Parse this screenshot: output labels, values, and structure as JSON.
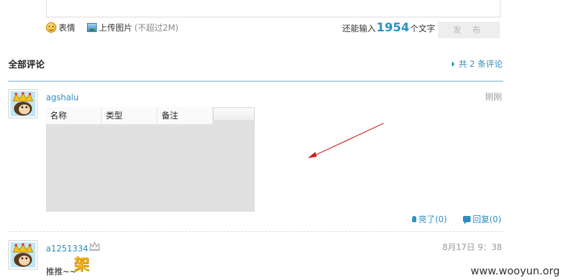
{
  "composer": {
    "emoji_label": "表情",
    "upload_label": "上传图片",
    "upload_limit": "(不超过2M)",
    "remaining_prefix": "还能输入",
    "remaining_count": "1954",
    "remaining_suffix": "个文字",
    "publish_label": "发 布"
  },
  "comments_header": {
    "title": "全部评论",
    "total_label": "共 2 条评论"
  },
  "comments": [
    {
      "username": "agshalu",
      "time": "刚刚",
      "attachment_columns": [
        "名称",
        "类型",
        "备注"
      ],
      "like_label": "亮了(0)",
      "reply_label": "回复(0)"
    },
    {
      "username": "a1251334",
      "time": "8月17日 9：38",
      "text": "推推~~",
      "sticker": "架"
    }
  ],
  "watermark": "www.wooyun.org",
  "colors": {
    "accent": "#2e8fc0",
    "arrow": "#cc2222"
  }
}
